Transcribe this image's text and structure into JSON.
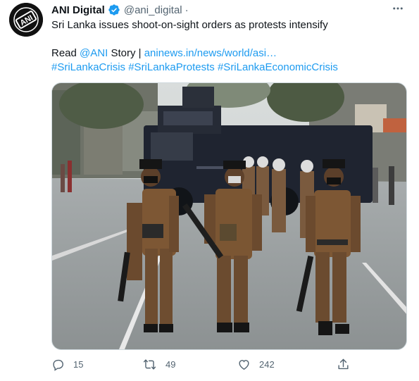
{
  "author": {
    "name": "ANI Digital",
    "handle": "@ani_digital",
    "separator": "·",
    "avatar_text": "ANI",
    "verified": true
  },
  "tweet": {
    "text": "Sri Lanka issues shoot-on-sight orders as protests intensify",
    "read_prefix": "Read",
    "mention": "@ANI",
    "read_suffix": "Story |",
    "link": "aninews.in/news/world/asi…",
    "hashtags": [
      "#SriLankaCrisis",
      "#SriLankaProtests",
      "#SriLankaEconomicCrisis"
    ]
  },
  "actions": {
    "replies": "15",
    "retweets": "49",
    "likes": "242"
  },
  "icons": {
    "more": "more-icon",
    "verified": "verified-badge-icon",
    "reply": "reply-icon",
    "retweet": "retweet-icon",
    "like": "like-icon",
    "share": "share-icon"
  },
  "colors": {
    "accent": "#1d9bf0",
    "text": "#0f1419",
    "secondary": "#536471"
  }
}
